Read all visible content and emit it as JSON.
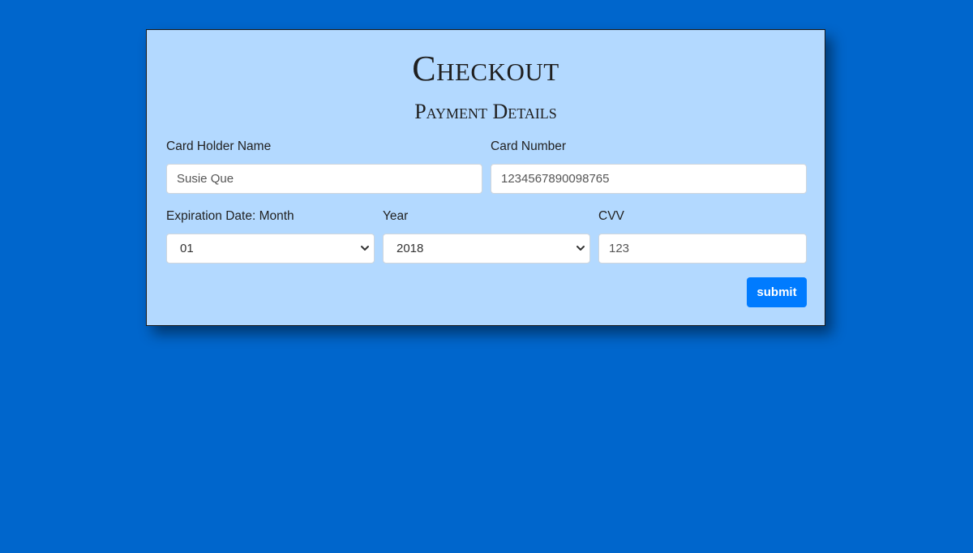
{
  "checkout": {
    "title": "Checkout",
    "subtitle": "Payment Details"
  },
  "form": {
    "card_holder": {
      "label": "Card Holder Name",
      "placeholder": "Susie Que"
    },
    "card_number": {
      "label": "Card Number",
      "placeholder": "1234567890098765"
    },
    "exp_month": {
      "label": "Expiration Date: Month",
      "value": "01"
    },
    "exp_year": {
      "label": "Year",
      "value": "2018"
    },
    "cvv": {
      "label": "CVV",
      "placeholder": "123"
    },
    "submit_label": "submit"
  },
  "icons": {
    "select_arrow": "chevron-down-icon"
  },
  "colors": {
    "page_background": "#0066cc",
    "card_background": "#b3d9ff",
    "button": "#007bff"
  }
}
